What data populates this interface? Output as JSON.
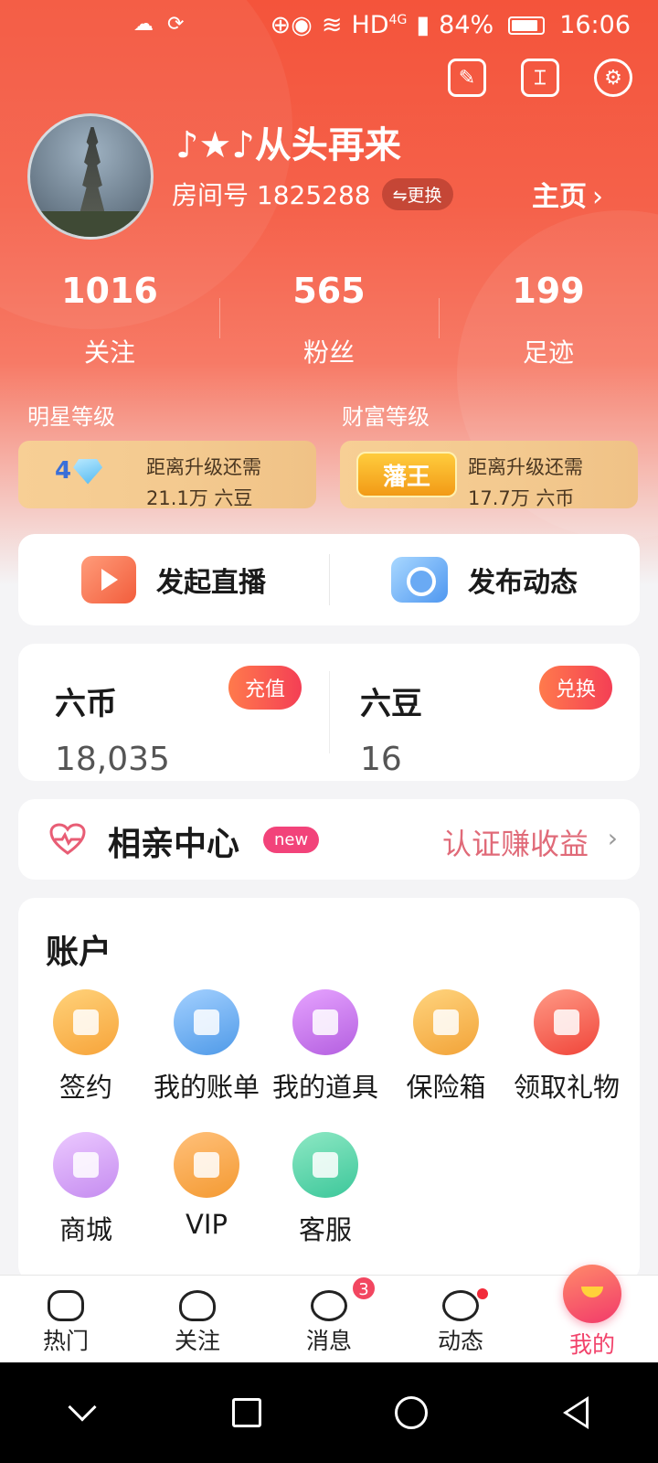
{
  "status_bar": {
    "network": "HD",
    "net_gen": "4G",
    "battery": "84%",
    "time": "16:06"
  },
  "profile": {
    "username": "♪★♪从头再来",
    "room_id": "房间号 1825288",
    "swap_label": "⇋更换",
    "homepage_label": "主页",
    "stats": [
      {
        "value": "1016",
        "label": "关注"
      },
      {
        "value": "565",
        "label": "粉丝"
      },
      {
        "value": "199",
        "label": "足迹"
      }
    ]
  },
  "levels": {
    "star": {
      "title": "明星等级",
      "badge": "4",
      "line1": "距离升级还需",
      "line2": "21.1万 六豆"
    },
    "wealth": {
      "title": "财富等级",
      "badge": "藩王",
      "line1": "距离升级还需",
      "line2": "17.7万 六币"
    }
  },
  "actions": {
    "live": "发起直播",
    "post": "发布动态"
  },
  "wallet": {
    "coin": {
      "name": "六币",
      "value": "18,035",
      "button": "充值"
    },
    "bean": {
      "name": "六豆",
      "value": "16",
      "button": "兑换"
    }
  },
  "dating": {
    "title": "相亲中心",
    "badge": "new",
    "earn": "认证赚收益"
  },
  "account": {
    "title": "账户",
    "items": [
      {
        "label": "签约",
        "icon": "contract-icon",
        "color": "#f7a43a"
      },
      {
        "label": "我的账单",
        "icon": "bill-icon",
        "color": "#4f9ae8"
      },
      {
        "label": "我的道具",
        "icon": "props-icon",
        "color": "#b45fe0"
      },
      {
        "label": "保险箱",
        "icon": "safe-icon",
        "color": "#f2a338"
      },
      {
        "label": "领取礼物",
        "icon": "gift-icon",
        "color": "#f0453a"
      },
      {
        "label": "商城",
        "icon": "shop-icon",
        "color": "#c58cf0"
      },
      {
        "label": "VIP",
        "icon": "vip-icon",
        "color": "#f49a32"
      },
      {
        "label": "客服",
        "icon": "support-icon",
        "color": "#3cc79a"
      }
    ]
  },
  "tabbar": {
    "tabs": [
      {
        "label": "热门"
      },
      {
        "label": "关注"
      },
      {
        "label": "消息",
        "badge": "3"
      },
      {
        "label": "动态"
      },
      {
        "label": "我的"
      }
    ]
  }
}
